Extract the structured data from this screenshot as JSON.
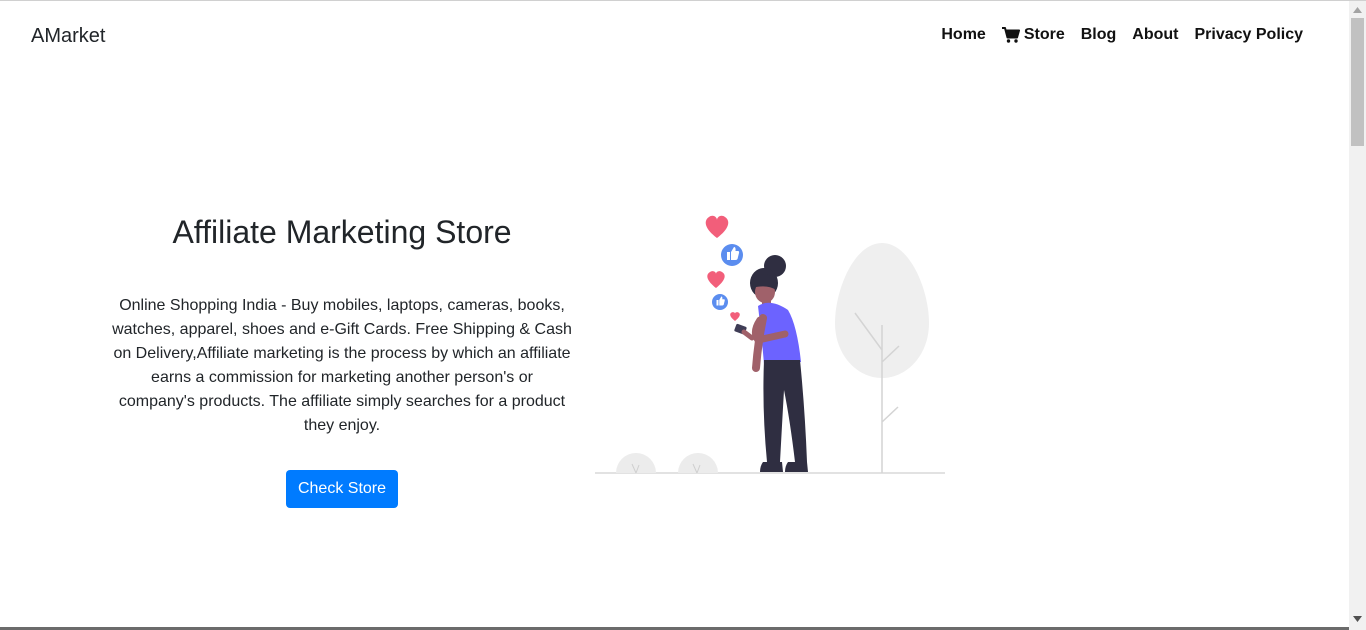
{
  "navbar": {
    "brand": "AMarket",
    "links": [
      {
        "label": "Home",
        "icon": null
      },
      {
        "label": "Store",
        "icon": "shopping-cart-icon"
      },
      {
        "label": "Blog",
        "icon": null
      },
      {
        "label": "About",
        "icon": null
      },
      {
        "label": "Privacy Policy",
        "icon": null
      }
    ]
  },
  "hero": {
    "title": "Affiliate Marketing Store",
    "description": "Online Shopping India - Buy mobiles, laptops, cameras, books, watches, apparel, shoes and e-Gift Cards. Free Shipping & Cash on Delivery,Affiliate marketing is the process by which an affiliate earns a commission for marketing another person's or company's products. The affiliate simply searches for a product they enjoy.",
    "cta_label": "Check Store"
  },
  "colors": {
    "primary": "#007bff",
    "heart": "#f25e7a",
    "like": "#5b8def",
    "shirt": "#6c63ff",
    "pants": "#2f2e41"
  }
}
